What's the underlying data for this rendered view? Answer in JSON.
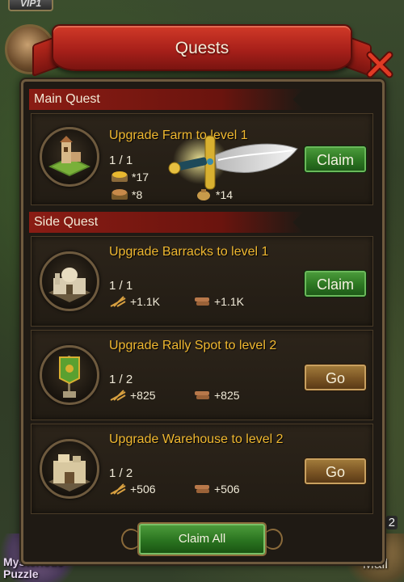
{
  "background": {
    "vip_label": "VIP1",
    "bottom_left_label": "Mysterious Puzzle",
    "mail_label": "Mail",
    "side_number": "2"
  },
  "dialog": {
    "title": "Quests",
    "close_icon": "close-x-icon"
  },
  "main_quest": {
    "header": "Main Quest",
    "quest": {
      "title": "Upgrade Farm to level 1",
      "progress": "1 / 1",
      "rewards": [
        {
          "icon": "food-crate-icon",
          "text": "*17"
        },
        {
          "icon": "wood-crate-icon",
          "text": "*8"
        },
        {
          "icon": "coin-bag-icon",
          "text": "*14"
        }
      ],
      "button": "Claim",
      "icon": "farm-building-icon"
    }
  },
  "side_quest": {
    "header": "Side Quest",
    "quests": [
      {
        "title": "Upgrade Barracks to level 1",
        "progress": "1 / 1",
        "reward_food": "+1.1K",
        "reward_wood": "+1.1K",
        "button": "Claim",
        "icon": "barracks-building-icon"
      },
      {
        "title": "Upgrade Rally Spot to level 2",
        "progress": "1 / 2",
        "reward_food": "+825",
        "reward_wood": "+825",
        "button": "Go",
        "icon": "rally-banner-icon"
      },
      {
        "title": "Upgrade Warehouse to level 2",
        "progress": "1 / 2",
        "reward_food": "+506",
        "reward_wood": "+506",
        "button": "Go",
        "icon": "warehouse-building-icon"
      }
    ]
  },
  "footer": {
    "claim_all": "Claim All"
  },
  "colors": {
    "quest_title": "#f0b830",
    "claim_green": "#2f7a24",
    "go_gold": "#7a5424",
    "ribbon_red": "#a8201a"
  }
}
